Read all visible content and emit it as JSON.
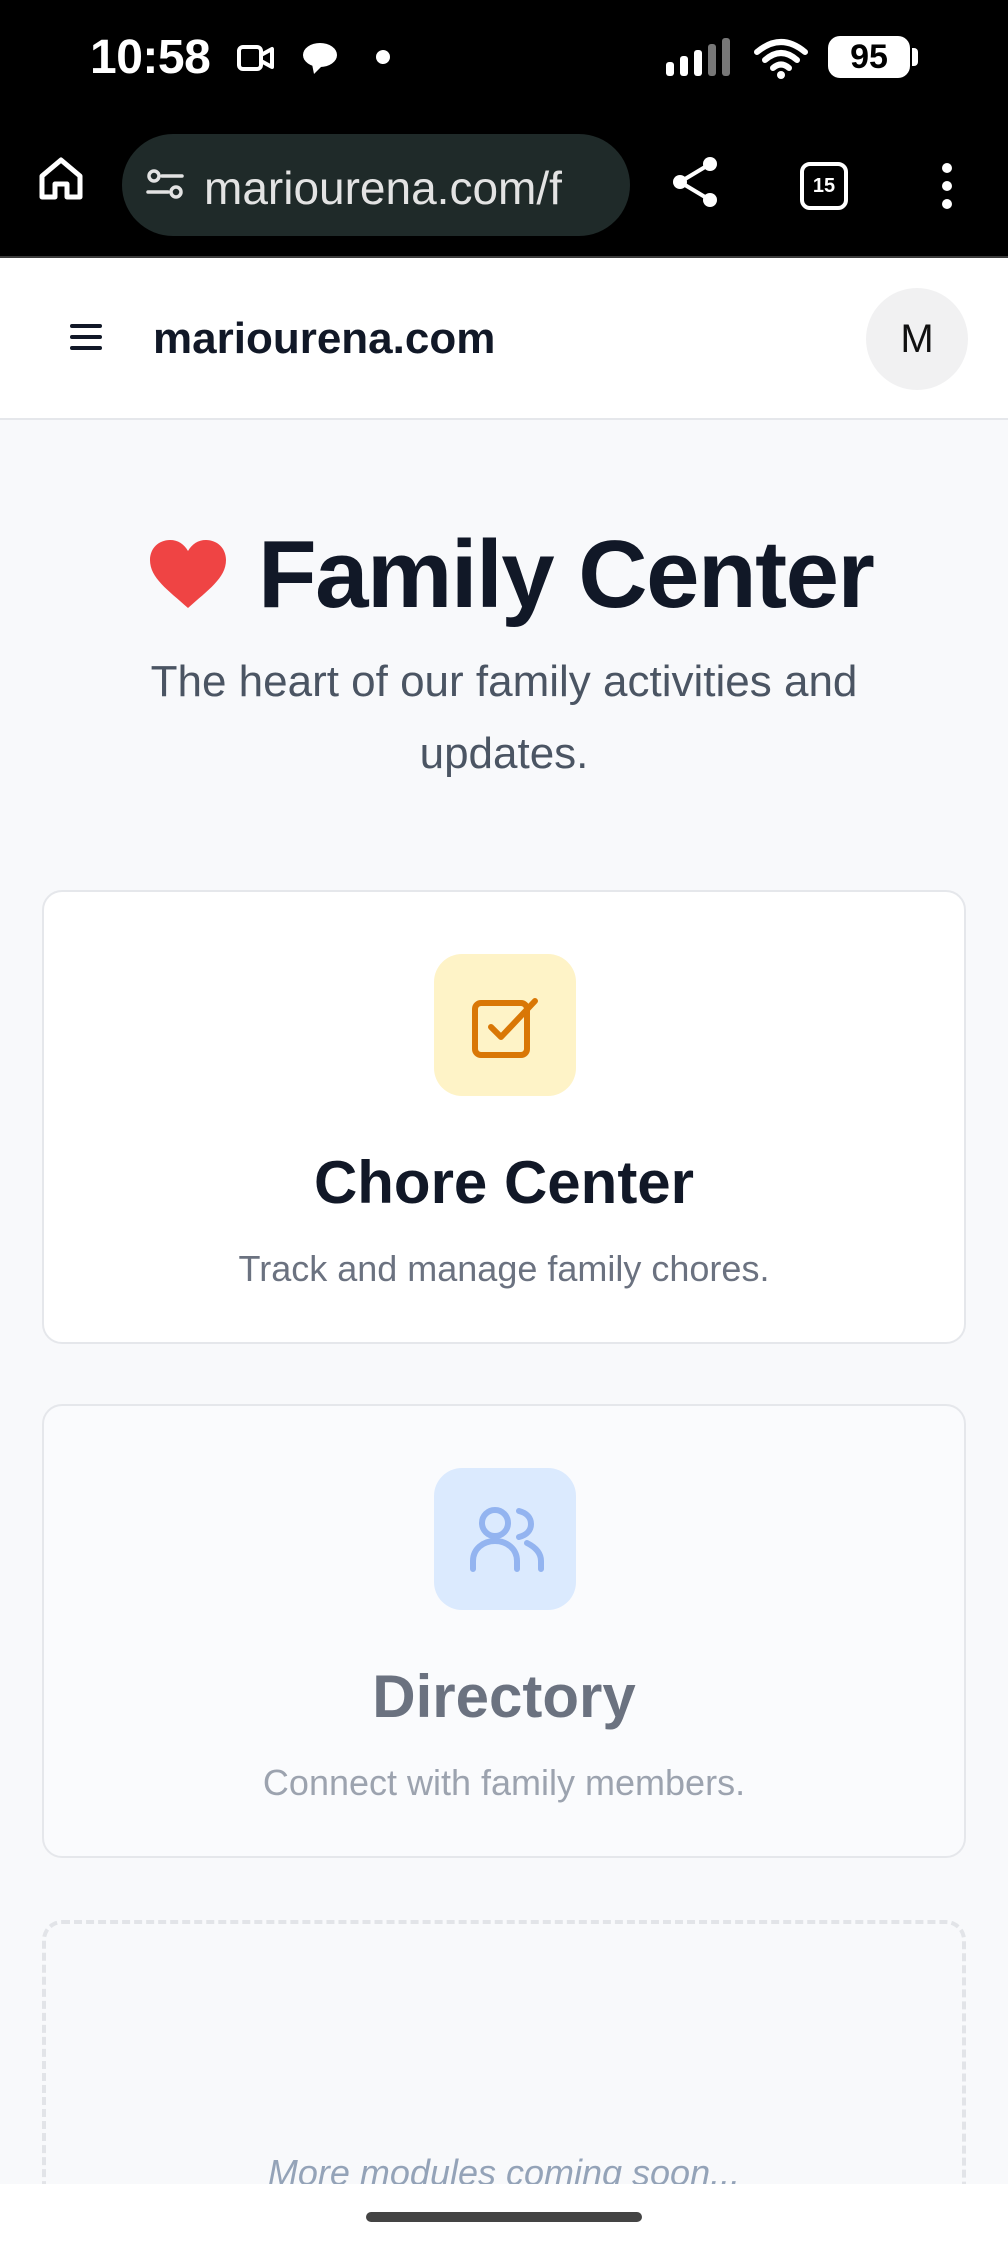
{
  "status_bar": {
    "time": "10:58",
    "battery": "95",
    "icons": [
      "video-camera-icon",
      "chat-bubble-icon",
      "dot-icon",
      "signal-icon",
      "wifi-icon",
      "battery-icon"
    ]
  },
  "browser": {
    "url": "mariourena.com/f",
    "tab_count": "15",
    "icons": [
      "home-icon",
      "site-settings-icon",
      "share-icon",
      "tabs-icon",
      "more-menu-icon"
    ]
  },
  "header": {
    "site_name": "mariourena.com",
    "avatar_initial": "M"
  },
  "hero": {
    "title": "Family Center",
    "subtitle": "The heart of our family activities and updates."
  },
  "modules": [
    {
      "title": "Chore Center",
      "description": "Track and manage family chores.",
      "icon": "checkbox-icon",
      "icon_bg": "#fef3c7",
      "icon_color": "#d97706"
    },
    {
      "title": "Directory",
      "description": "Connect with family members.",
      "icon": "users-icon",
      "icon_bg": "#dbeafe",
      "icon_color": "#93b4f0"
    }
  ],
  "coming_soon": "More modules coming soon...",
  "colors": {
    "heart": "#ef4444",
    "title": "#111827",
    "background": "#f8f9fb"
  }
}
